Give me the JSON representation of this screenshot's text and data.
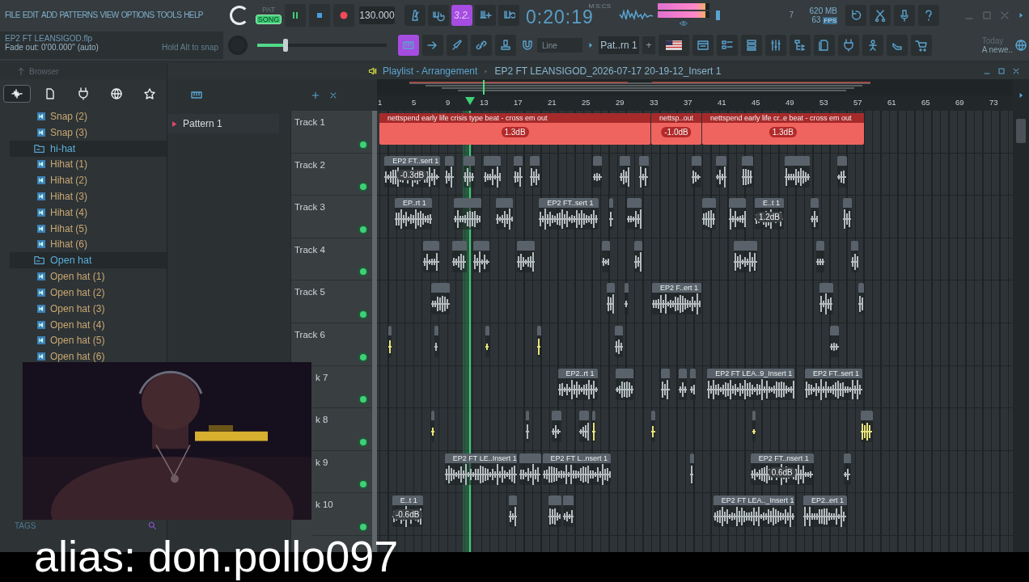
{
  "menu": [
    "FILE",
    "EDIT",
    "ADD",
    "PATTERNS",
    "VIEW",
    "OPTIONS",
    "TOOLS",
    "HELP"
  ],
  "hint": {
    "file": "EP2 FT LEANSIGOD.flp",
    "status": "Fade out: 0'00.000'' (auto)",
    "tip": "Hold Alt to snap"
  },
  "mode": [
    {
      "label": "PAT",
      "selected": false
    },
    {
      "label": "SONG",
      "selected": true
    }
  ],
  "tempo": "130.000",
  "snap_button": {
    "label": "3.2.",
    "on": true
  },
  "time": {
    "value": "0:20:19",
    "unit": "M:S:CS"
  },
  "peak_meters": [
    {
      "level": 0.92
    },
    {
      "level": 0.92
    }
  ],
  "voices": "7",
  "memory": "620 MB",
  "cpu": {
    "value": "63",
    "badge": "FPS"
  },
  "master_volume": {
    "level": 0.22
  },
  "keyboard_button": {
    "on": true
  },
  "snap_mode": "Line",
  "pattern_selector": {
    "value": "Pat..rn 1",
    "add": "+"
  },
  "news": {
    "title": "Today",
    "text": "A newe.."
  },
  "browser": {
    "title": "Browser",
    "tabs": [
      {
        "selected": true
      },
      {
        "selected": false
      },
      {
        "selected": false
      },
      {
        "selected": false
      },
      {
        "selected": false
      }
    ],
    "items": [
      {
        "kind": "file",
        "label": "Snap  (2)"
      },
      {
        "kind": "file",
        "label": "Snap  (3)"
      },
      {
        "kind": "folder",
        "label": "hi-hat",
        "expanded": true,
        "children": [
          {
            "kind": "file",
            "label": "Hihat (1)"
          },
          {
            "kind": "file",
            "label": "Hihat (2)"
          },
          {
            "kind": "file",
            "label": "Hihat (3)"
          },
          {
            "kind": "file",
            "label": "Hihat (4)"
          },
          {
            "kind": "file",
            "label": "Hihat (5)"
          },
          {
            "kind": "file",
            "label": "Hihat (6)"
          }
        ]
      },
      {
        "kind": "folder",
        "label": "Open hat",
        "expanded": true,
        "children": [
          {
            "kind": "file",
            "label": "Open hat (1)"
          },
          {
            "kind": "file",
            "label": "Open hat (2)"
          },
          {
            "kind": "file",
            "label": "Open hat (3)"
          },
          {
            "kind": "file",
            "label": "Open hat (4)"
          },
          {
            "kind": "file",
            "label": "Open hat (5)"
          },
          {
            "kind": "file",
            "label": "Open hat (6)"
          }
        ]
      }
    ],
    "tags_label": "TAGS"
  },
  "patterns": [
    {
      "name": "Pattern 1"
    }
  ],
  "playlist": {
    "title": "Playlist - Arrangement",
    "clip_name": "EP2 FT LEANSIGOD_2026-07-17 20-19-12_Insert 1",
    "ruler": [
      "1",
      "5",
      "9",
      "13",
      "17",
      "21",
      "25",
      "29",
      "33",
      "37",
      "41",
      "45",
      "49",
      "53",
      "57",
      "61",
      "65",
      "69",
      "73"
    ],
    "tracks": [
      {
        "name": "Track 1",
        "cut": false,
        "clips": [
          {
            "kind": "filled",
            "color": "#f0645f",
            "label": "nettspend early life crisis type beat - cross em out",
            "gain": "1.3dB"
          },
          {
            "kind": "filled",
            "color": "#f0645f",
            "label": "nettsp..out",
            "gain": "-1.0dB"
          },
          {
            "kind": "filled",
            "color": "#f0645f",
            "label": "nettspend early life cr..e beat - cross em out",
            "gain": "1.3dB"
          }
        ]
      },
      {
        "name": "Track 2",
        "cut": false,
        "clips": [
          {
            "kind": "wave",
            "color": "#b4bcbf",
            "label": "EP2 FT..sert 1",
            "gain": "-0.3dB"
          },
          {
            "kind": "wave",
            "color": "#b4bcbf"
          },
          {
            "kind": "wave",
            "color": "#b4bcbf"
          },
          {
            "kind": "wave",
            "color": "#b4bcbf"
          },
          {
            "kind": "wave",
            "color": "#b4bcbf"
          },
          {
            "kind": "wave",
            "color": "#b4bcbf"
          },
          {
            "kind": "wave",
            "color": "#b4bcbf"
          },
          {
            "kind": "wave",
            "color": "#b4bcbf"
          },
          {
            "kind": "wave",
            "color": "#b4bcbf"
          },
          {
            "kind": "wave",
            "color": "#b4bcbf"
          },
          {
            "kind": "wave",
            "color": "#b4bcbf"
          },
          {
            "kind": "wave",
            "color": "#b4bcbf"
          },
          {
            "kind": "wave",
            "color": "#b4bcbf"
          },
          {
            "kind": "wave",
            "color": "#b4bcbf"
          }
        ]
      },
      {
        "name": "Track 3",
        "cut": false,
        "clips": [
          {
            "kind": "wave",
            "color": "#b4bcbf",
            "label": "EP..rt 1"
          },
          {
            "kind": "wave",
            "color": "#b4bcbf"
          },
          {
            "kind": "wave",
            "color": "#b4bcbf"
          },
          {
            "kind": "wave",
            "color": "#b4bcbf",
            "label": "EP2 FT..sert 1"
          },
          {
            "kind": "wave",
            "color": "#b4bcbf"
          },
          {
            "kind": "wave",
            "color": "#b4bcbf"
          },
          {
            "kind": "wave",
            "color": "#b4bcbf"
          },
          {
            "kind": "wave",
            "color": "#b4bcbf"
          },
          {
            "kind": "wave",
            "color": "#b4bcbf",
            "label": "E..t 1",
            "gain": "1.2dB"
          },
          {
            "kind": "wave",
            "color": "#b4bcbf"
          },
          {
            "kind": "wave",
            "color": "#b4bcbf"
          }
        ]
      },
      {
        "name": "Track 4",
        "cut": false,
        "clips": [
          {
            "kind": "wave",
            "color": "#b4bcbf"
          },
          {
            "kind": "wave",
            "color": "#b4bcbf"
          },
          {
            "kind": "wave",
            "color": "#b4bcbf"
          },
          {
            "kind": "wave",
            "color": "#b4bcbf"
          },
          {
            "kind": "wave",
            "color": "#b4bcbf"
          },
          {
            "kind": "wave",
            "color": "#b4bcbf"
          },
          {
            "kind": "wave",
            "color": "#b4bcbf"
          },
          {
            "kind": "wave",
            "color": "#b4bcbf"
          },
          {
            "kind": "wave",
            "color": "#b4bcbf"
          }
        ]
      },
      {
        "name": "Track 5",
        "cut": false,
        "clips": [
          {
            "kind": "wave",
            "color": "#b4bcbf"
          },
          {
            "kind": "wave",
            "color": "#b4bcbf"
          },
          {
            "kind": "wave",
            "color": "#b4bcbf"
          },
          {
            "kind": "wave",
            "color": "#b4bcbf",
            "label": "EP2 F..ert 1"
          },
          {
            "kind": "wave",
            "color": "#b4bcbf"
          },
          {
            "kind": "wave",
            "color": "#b4bcbf"
          }
        ]
      },
      {
        "name": "Track 6",
        "cut": false,
        "clips": [
          {
            "kind": "wave",
            "color": "#e8e27a"
          },
          {
            "kind": "wave",
            "color": "#b4bcbf"
          },
          {
            "kind": "wave",
            "color": "#e8e27a"
          },
          {
            "kind": "wave",
            "color": "#e8e27a"
          },
          {
            "kind": "wave",
            "color": "#b4bcbf"
          },
          {
            "kind": "wave",
            "color": "#b4bcbf"
          }
        ]
      },
      {
        "name": "k 7",
        "cut": true,
        "clips": [
          {
            "kind": "wave",
            "color": "#b4bcbf",
            "label": "EP2..rt 1"
          },
          {
            "kind": "wave",
            "color": "#b4bcbf"
          },
          {
            "kind": "wave",
            "color": "#b4bcbf"
          },
          {
            "kind": "wave",
            "color": "#b4bcbf"
          },
          {
            "kind": "wave",
            "color": "#b4bcbf"
          },
          {
            "kind": "wave",
            "color": "#b4bcbf",
            "label": "EP2 FT LEA..9_Insert 1"
          },
          {
            "kind": "wave",
            "color": "#b4bcbf",
            "label": "EP2 FT..sert 1"
          }
        ]
      },
      {
        "name": "k 8",
        "cut": true,
        "clips": [
          {
            "kind": "wave",
            "color": "#e8e27a"
          },
          {
            "kind": "wave",
            "color": "#b4bcbf"
          },
          {
            "kind": "wave",
            "color": "#b4bcbf"
          },
          {
            "kind": "wave",
            "color": "#b4bcbf"
          },
          {
            "kind": "wave",
            "color": "#e8e27a"
          },
          {
            "kind": "wave",
            "color": "#e8e27a"
          },
          {
            "kind": "wave",
            "color": "#e8e27a"
          },
          {
            "kind": "wave",
            "color": "#e8e27a"
          }
        ]
      },
      {
        "name": "k 9",
        "cut": true,
        "clips": [
          {
            "kind": "wave",
            "color": "#b4bcbf",
            "label": "EP2 FT LE..Insert 1"
          },
          {
            "kind": "wave",
            "color": "#b4bcbf"
          },
          {
            "kind": "wave",
            "color": "#b4bcbf",
            "label": "EP2 FT L..nsert 1"
          },
          {
            "kind": "wave",
            "color": "#b4bcbf"
          },
          {
            "kind": "wave",
            "color": "#b4bcbf",
            "label": "EP2 FT..nsert 1",
            "gain": "0.6dB"
          },
          {
            "kind": "wave",
            "color": "#b4bcbf"
          }
        ]
      },
      {
        "name": "k 10",
        "cut": true,
        "clips": [
          {
            "kind": "wave",
            "color": "#b4bcbf",
            "label": "E..t 1",
            "gain": "-0.6dB"
          },
          {
            "kind": "wave",
            "color": "#b4bcbf"
          },
          {
            "kind": "wave",
            "color": "#b4bcbf"
          },
          {
            "kind": "wave",
            "color": "#b4bcbf"
          },
          {
            "kind": "wave",
            "color": "#b4bcbf",
            "label": "EP2 FT LEA.._Insert 1"
          },
          {
            "kind": "wave",
            "color": "#b4bcbf",
            "label": "EP2..ert 1"
          }
        ]
      }
    ]
  },
  "webcam": {
    "kind": "picture"
  },
  "caption": "alias: don.pollo097"
}
